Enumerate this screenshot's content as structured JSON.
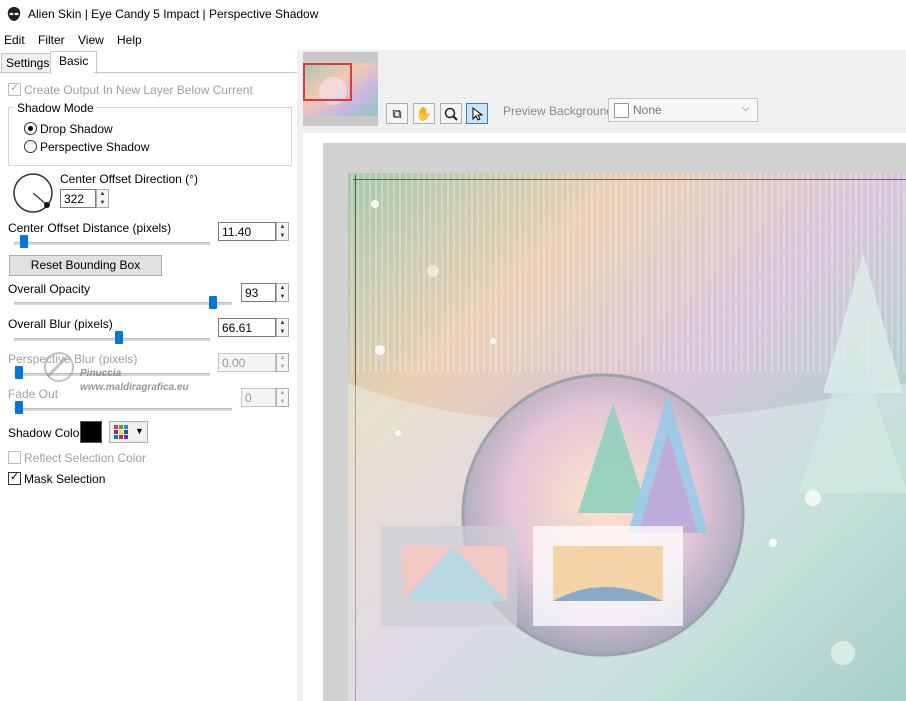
{
  "window": {
    "title": "Alien Skin | Eye Candy 5 Impact | Perspective Shadow"
  },
  "menu": [
    "Edit",
    "Filter",
    "View",
    "Help"
  ],
  "tabs": {
    "settings": "Settings",
    "basic": "Basic"
  },
  "options": {
    "create_output": "Create Output In New Layer Below Current",
    "shadow_mode_group": "Shadow Mode",
    "drop_shadow": "Drop Shadow",
    "perspective_shadow": "Perspective Shadow",
    "shadow_mode_selected": "Drop Shadow",
    "center_offset_direction_label": "Center Offset Direction (°)",
    "center_offset_direction_value": "322",
    "center_offset_distance_label": "Center Offset Distance (pixels)",
    "center_offset_distance_value": "11.40",
    "reset_bounding_box": "Reset Bounding Box",
    "overall_opacity_label": "Overall Opacity",
    "overall_opacity_value": "93",
    "overall_blur_label": "Overall Blur (pixels)",
    "overall_blur_value": "66.61",
    "perspective_blur_label": "Perspective Blur (pixels)",
    "perspective_blur_value": "0.00",
    "fade_out_label": "Fade Out",
    "fade_out_value": "0",
    "shadow_color_label": "Shadow Color",
    "shadow_color": "#000000",
    "reflect_selection_color": "Reflect Selection Color",
    "mask_selection": "Mask Selection",
    "mask_selection_checked": true
  },
  "sliders": {
    "center_offset_distance": 0.11,
    "overall_opacity": 0.93,
    "overall_blur": 0.5,
    "perspective_blur": 0.0,
    "fade_out": 0.0
  },
  "preview": {
    "background_label": "Preview Background:",
    "background_value": "None"
  },
  "watermark": {
    "line1": "Pinuccia",
    "line2": "www.maldiragrafica.eu"
  },
  "colors": {
    "accent": "#0078d7",
    "thumb_highlight": "#e03a3a"
  }
}
